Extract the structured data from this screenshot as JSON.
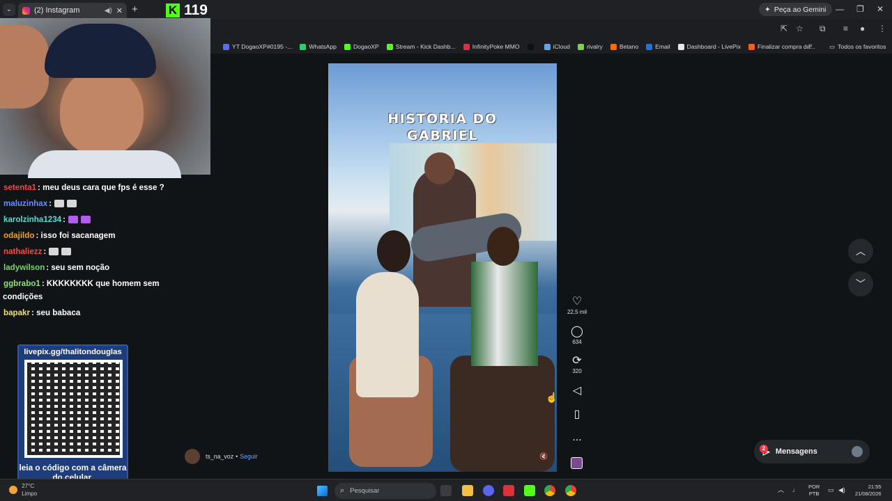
{
  "browser": {
    "tab_title": "(2) Instagram",
    "new_tab": "+",
    "gemini_label": "Peça ao Gemini",
    "bookmarks": [
      {
        "label": "YT DogaoXP#0195 -...",
        "color": "#5a6cf0"
      },
      {
        "label": "WhatsApp",
        "color": "#25d366"
      },
      {
        "label": "DogaoXP",
        "color": "#53fc18"
      },
      {
        "label": "Stream - Kick Dashb...",
        "color": "#53fc18"
      },
      {
        "label": "InfinityPoke MMO",
        "color": "#e0303a"
      },
      {
        "label": "",
        "color": "#111111"
      },
      {
        "label": "iCloud",
        "color": "#5aa9f0"
      },
      {
        "label": "rivalry",
        "color": "#7cd33b"
      },
      {
        "label": "Betano",
        "color": "#ff6a00"
      },
      {
        "label": "Email",
        "color": "#1a73e8"
      },
      {
        "label": "Dashboard - LivePix",
        "color": "#e8e8e8"
      },
      {
        "label": "Finalizar compra da...",
        "color": "#ff5a1f"
      }
    ],
    "bookmarks_more": "»",
    "all_favorites": "Todos os favoritos"
  },
  "stream": {
    "viewer_count": "119",
    "chat": [
      {
        "user": "setenta1",
        "color": "#ff4040",
        "msg": ": meu deus cara que fps é esse ?",
        "emotes": 0
      },
      {
        "user": "maluzinhax",
        "color": "#6b8cff",
        "msg": ":",
        "emotes": 2
      },
      {
        "user": "karolzinha1234",
        "color": "#53e0d2",
        "msg": ":",
        "emotes": 2
      },
      {
        "user": "odajildo",
        "color": "#f0a030",
        "msg": ": isso foi sacanagem",
        "emotes": 0
      },
      {
        "user": "nathaliezz",
        "color": "#ff4a3d",
        "msg": ":",
        "emotes": 2
      },
      {
        "user": "ladywilson",
        "color": "#7bd36b",
        "msg": ": seu sem noção",
        "emotes": 0
      },
      {
        "user": "ggbrabo1",
        "color": "#8ee07a",
        "msg": ": KKKKKKKK que homem sem",
        "emotes": 0
      },
      {
        "user": "",
        "color": "#ffffff",
        "msg": "condições",
        "emotes": 0
      },
      {
        "user": "bapakr",
        "color": "#f0e070",
        "msg": ": seu babaca",
        "emotes": 0
      }
    ],
    "livepix_url": "livepix.gg/thalitondouglas",
    "livepix_cta": "leia o código com a câmera do celular."
  },
  "post": {
    "video_title_line1": "HISTORIA DO",
    "video_title_line2": "GABRIEL",
    "author": "ts_na_voz",
    "separator": "•",
    "follow_label": "Seguir",
    "likes": "22,5 mil",
    "comments": "634",
    "reposts": "320",
    "more": "..."
  },
  "page": {
    "messages_label": "Mensagens",
    "messages_badge": "2"
  },
  "taskbar": {
    "weather_temp": "27°C",
    "weather_desc": "Limpo",
    "search_placeholder": "Pesquisar",
    "lang_line1": "POR",
    "lang_line2": "PTB",
    "time": "21:55",
    "date": "21/08/2026"
  }
}
